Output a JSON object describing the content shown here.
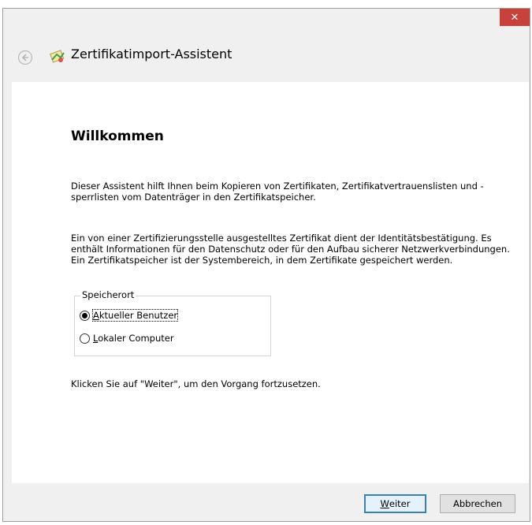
{
  "window": {
    "title": "Zertifikatimport-Assistent",
    "close_symbol": "✕"
  },
  "content": {
    "heading": "Willkommen",
    "paragraph1": "Dieser Assistent hilft Ihnen beim Kopieren von Zertifikaten, Zertifikatvertrauenslisten und -sperrlisten vom Datenträger in den Zertifikatspeicher.",
    "paragraph2": "Ein von einer Zertifizierungsstelle ausgestelltes Zertifikat dient der Identitätsbestätigung. Es enthält Informationen für den Datenschutz oder für den Aufbau sicherer Netzwerkverbindungen. Ein Zertifikatspeicher ist der Systembereich, in dem Zertifikate gespeichert werden.",
    "store_group": {
      "label": "Speicherort",
      "options": [
        {
          "mnemonic": "A",
          "rest": "ktueller Benutzer",
          "selected": true
        },
        {
          "mnemonic": "L",
          "rest": "okaler Computer",
          "selected": false
        }
      ]
    },
    "paragraph3": "Klicken Sie auf \"Weiter\", um den Vorgang fortzusetzen."
  },
  "footer": {
    "next": {
      "mnemonic": "W",
      "rest": "eiter"
    },
    "cancel_label": "Abbrechen"
  },
  "colors": {
    "close_red": "#c8413a",
    "focus_blue": "#3c7fb1"
  }
}
